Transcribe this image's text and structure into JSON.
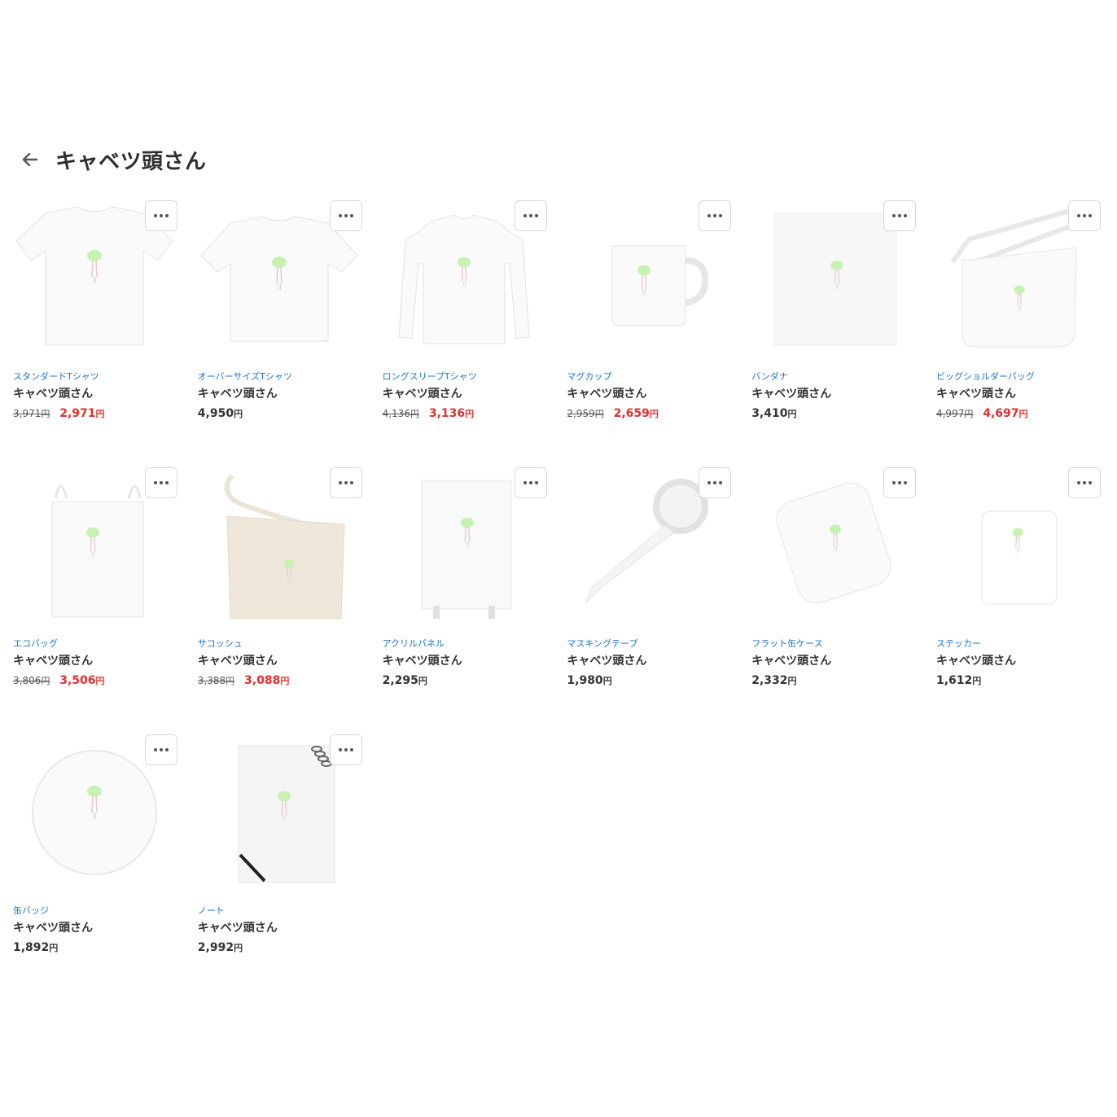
{
  "page": {
    "title": "キャベツ頭さん"
  },
  "products": [
    {
      "category": "スタンダードTシャツ",
      "name": "キャベツ頭さん",
      "original_price": "3,971",
      "price": "2,971",
      "on_sale": true,
      "image": "tshirt"
    },
    {
      "category": "オーバーサイズTシャツ",
      "name": "キャベツ頭さん",
      "original_price": "",
      "price": "4,950",
      "on_sale": false,
      "image": "oversize-tshirt"
    },
    {
      "category": "ロングスリーブTシャツ",
      "name": "キャベツ頭さん",
      "original_price": "4,136",
      "price": "3,136",
      "on_sale": true,
      "image": "longsleeve"
    },
    {
      "category": "マグカップ",
      "name": "キャベツ頭さん",
      "original_price": "2,959",
      "price": "2,659",
      "on_sale": true,
      "image": "mug"
    },
    {
      "category": "バンダナ",
      "name": "キャベツ頭さん",
      "original_price": "",
      "price": "3,410",
      "on_sale": false,
      "image": "bandana"
    },
    {
      "category": "ビッグショルダーバッグ",
      "name": "キャベツ頭さん",
      "original_price": "4,997",
      "price": "4,697",
      "on_sale": true,
      "image": "shoulder-bag"
    },
    {
      "category": "エコバッグ",
      "name": "キャベツ頭さん",
      "original_price": "3,806",
      "price": "3,506",
      "on_sale": true,
      "image": "eco-bag"
    },
    {
      "category": "サコッシュ",
      "name": "キャベツ頭さん",
      "original_price": "3,388",
      "price": "3,088",
      "on_sale": true,
      "image": "sacoche"
    },
    {
      "category": "アクリルパネル",
      "name": "キャベツ頭さん",
      "original_price": "",
      "price": "2,295",
      "on_sale": false,
      "image": "acrylic-panel"
    },
    {
      "category": "マスキングテープ",
      "name": "キャベツ頭さん",
      "original_price": "",
      "price": "1,980",
      "on_sale": false,
      "image": "masking-tape"
    },
    {
      "category": "フラット缶ケース",
      "name": "キャベツ頭さん",
      "original_price": "",
      "price": "2,332",
      "on_sale": false,
      "image": "tin-case"
    },
    {
      "category": "ステッカー",
      "name": "キャベツ頭さん",
      "original_price": "",
      "price": "1,612",
      "on_sale": false,
      "image": "sticker"
    },
    {
      "category": "缶バッジ",
      "name": "キャベツ頭さん",
      "original_price": "",
      "price": "1,892",
      "on_sale": false,
      "image": "badge"
    },
    {
      "category": "ノート",
      "name": "キャベツ頭さん",
      "original_price": "",
      "price": "2,992",
      "on_sale": false,
      "image": "notebook"
    }
  ],
  "currency_suffix": "円",
  "colors": {
    "category_link": "#1a73c9",
    "sale_price": "#e52e2e",
    "text": "#333333",
    "art_green": "#c6f2b3"
  }
}
